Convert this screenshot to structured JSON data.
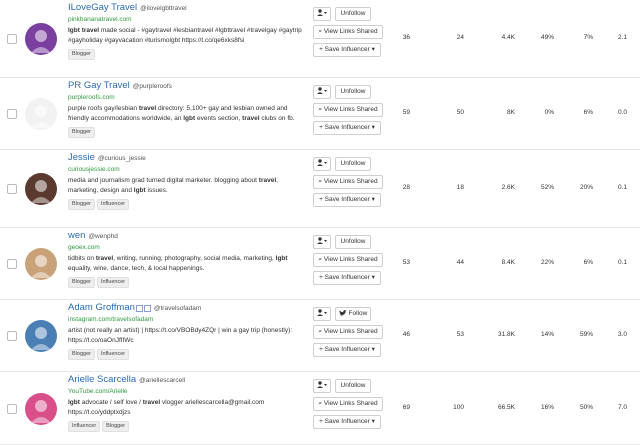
{
  "labels": {
    "unfollow": "Unfollow",
    "follow": "Follow",
    "view_links": "View Links Shared",
    "save": "+ Save Influencer"
  },
  "rows": [
    {
      "name": "ILoveGay Travel",
      "handle": "@ilovelgbttravel",
      "site": "pinkbananatravel.com",
      "bio_parts": [
        [
          "lgbt travel",
          true
        ],
        [
          " made social - #gaytravel #lesbiantravel #lgbttravel #travelgay #gaytrip #gayholiday #gayvacation #turismolgbt https://t.co/qe6xks8fsi",
          false
        ]
      ],
      "tags": [
        "Blogger"
      ],
      "follow_state": "Unfollow",
      "stats": [
        "36",
        "24",
        "4.4K",
        "49%",
        "7%",
        "2.1"
      ],
      "avatar_color": "#7b3fa0"
    },
    {
      "name": "PR Gay Travel",
      "handle": "@purpleroofs",
      "site": "purpleroofs.com",
      "bio_parts": [
        [
          "purple roofs gay/lesbian ",
          false
        ],
        [
          "travel",
          true
        ],
        [
          " directory: 5,100+ gay and lesbian owned and friendly accommodations worldwide, an ",
          false
        ],
        [
          "lgbt",
          true
        ],
        [
          " events section, ",
          false
        ],
        [
          "travel",
          true
        ],
        [
          " clubs on fb.",
          false
        ]
      ],
      "tags": [
        "Blogger"
      ],
      "follow_state": "Unfollow",
      "stats": [
        "59",
        "50",
        "8K",
        "0%",
        "6%",
        "0.0"
      ],
      "avatar_color": "#f2f2f2"
    },
    {
      "name": "Jessie",
      "handle": "@curious_jessie",
      "site": "curiousjessie.com",
      "bio_parts": [
        [
          "media and journalism grad turned digital marketer. blogging about ",
          false
        ],
        [
          "travel",
          true
        ],
        [
          ", marketing, design and ",
          false
        ],
        [
          "lgbt",
          true
        ],
        [
          " issues.",
          false
        ]
      ],
      "tags": [
        "Blogger",
        "Influencer"
      ],
      "follow_state": "Unfollow",
      "stats": [
        "28",
        "18",
        "2.6K",
        "52%",
        "20%",
        "0.1"
      ],
      "avatar_color": "#5a3a2e"
    },
    {
      "name": "wen",
      "handle": "@wenphd",
      "site": "geoex.com",
      "bio_parts": [
        [
          "tidbits on ",
          false
        ],
        [
          "travel",
          true
        ],
        [
          ", writing, running, photography, social media, marketing, ",
          false
        ],
        [
          "lgbt",
          true
        ],
        [
          " equality, wine, dance, tech, & local happenings.",
          false
        ]
      ],
      "tags": [
        "Blogger",
        "Influencer"
      ],
      "follow_state": "Unfollow",
      "stats": [
        "53",
        "44",
        "8.4K",
        "22%",
        "6%",
        "0.1"
      ],
      "avatar_color": "#c9a27a"
    },
    {
      "name": "Adam Groffman",
      "handle": "@travelsofadam",
      "site": "instagram.com/travelsofadam",
      "bio_parts": [
        [
          "artist (not really an artist) | https://t.co/VBOBdy4ZQr | win a gay trip (honestly): https://t.co/oaOnJffIWc",
          false
        ]
      ],
      "tags": [
        "Blogger",
        "Influencer"
      ],
      "follow_state": "Follow",
      "stats": [
        "46",
        "53",
        "31.8K",
        "14%",
        "59%",
        "3.0"
      ],
      "avatar_color": "#4a7fb5"
    },
    {
      "name": "Arielle Scarcella",
      "handle": "@ariellescarcell",
      "site": "YouTube.com/Arielle",
      "bio_parts": [
        [
          "lgbt",
          true
        ],
        [
          " advocate / self love / ",
          false
        ],
        [
          "travel",
          true
        ],
        [
          " vlogger ariellescarcella@gmail.com https://t.co/yddptxdjzs",
          false
        ]
      ],
      "tags": [
        "Influencer",
        "Blogger"
      ],
      "follow_state": "Unfollow",
      "stats": [
        "69",
        "100",
        "66.5K",
        "16%",
        "50%",
        "7.0"
      ],
      "avatar_color": "#d94f8a"
    }
  ]
}
